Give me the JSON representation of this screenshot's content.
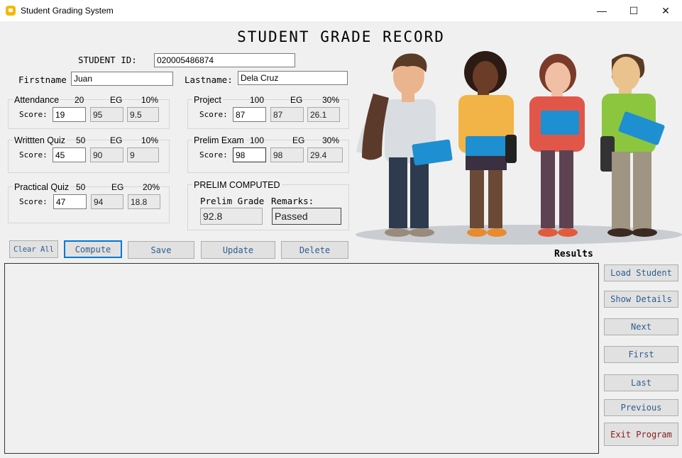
{
  "window": {
    "title": "Student Grading System",
    "minimize": "—",
    "maximize": "☐",
    "close": "✕"
  },
  "header": {
    "title": "STUDENT GRADE RECORD"
  },
  "student": {
    "id_label": "STUDENT ID:",
    "id": "020005486874",
    "firstname_label": "Firstname",
    "firstname": "Juan",
    "lastname_label": "Lastname:",
    "lastname": "Dela Cruz"
  },
  "components": [
    {
      "name": "Attendance",
      "max": "20",
      "eg": "EG",
      "weight": "10%",
      "score_label": "Score:",
      "score": "19",
      "computed": "95",
      "weighted": "9.5"
    },
    {
      "name": "Writtten Quiz",
      "max": "50",
      "eg": "EG",
      "weight": "10%",
      "score_label": "Score:",
      "score": "45",
      "computed": "90",
      "weighted": "9"
    },
    {
      "name": "Practical Quiz",
      "max": "50",
      "eg": "EG",
      "weight": "20%",
      "score_label": "Score:",
      "score": "47",
      "computed": "94",
      "weighted": "18.8"
    },
    {
      "name": "Project",
      "max": "100",
      "eg": "EG",
      "weight": "30%",
      "score_label": "Score:",
      "score": "87",
      "computed": "87",
      "weighted": "26.1"
    },
    {
      "name": "Prelim Exam",
      "max": "100",
      "eg": "EG",
      "weight": "30%",
      "score_label": "Score:",
      "score": "98",
      "computed": "98",
      "weighted": "29.4"
    }
  ],
  "prelim": {
    "title": "PRELIM COMPUTED",
    "grade_label": "Prelim Grade",
    "remarks_label": "Remarks:",
    "grade": "92.8",
    "remarks": "Passed"
  },
  "buttons": {
    "clear_all": "Clear All",
    "compute": "Compute",
    "save": "Save",
    "update": "Update",
    "delete": "Delete"
  },
  "results": {
    "label": "Results"
  },
  "side_buttons": {
    "load": "Load Student",
    "details": "Show Details",
    "next": "Next",
    "first": "First",
    "last": "Last",
    "previous": "Previous",
    "exit": "Exit Program"
  }
}
